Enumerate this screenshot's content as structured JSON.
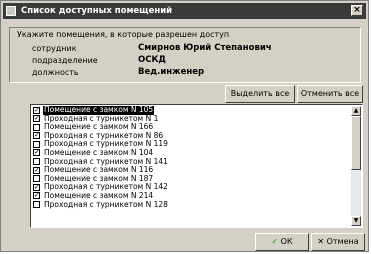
{
  "window": {
    "title": "Список доступных помещений",
    "close_glyph": "×"
  },
  "info": {
    "hint": "Укажите помещения, в которые разрешен доступ",
    "fields": [
      {
        "label": "сотрудник",
        "value": "Смирнов Юрий Степанович"
      },
      {
        "label": "подразделение",
        "value": "ОСКД"
      },
      {
        "label": "должность",
        "value": "Вед.инженер"
      }
    ]
  },
  "buttons": {
    "select_all": "Выделить все",
    "deselect_all": "Отменить все",
    "ok": "ОК",
    "cancel": "Отмена"
  },
  "rooms": [
    {
      "label": "Помещение с замком N 105",
      "checked": true,
      "selected": true
    },
    {
      "label": "Проходная с турникетом N 1",
      "checked": true,
      "selected": false
    },
    {
      "label": "Помещение с замком N 166",
      "checked": false,
      "selected": false
    },
    {
      "label": "Проходная с турникетом N 86",
      "checked": true,
      "selected": false
    },
    {
      "label": "Проходная с турникетом N 119",
      "checked": false,
      "selected": false
    },
    {
      "label": "Помещение с замком N 104",
      "checked": true,
      "selected": false
    },
    {
      "label": "Проходная с турникетом N 141",
      "checked": false,
      "selected": false
    },
    {
      "label": "Помещение с замком N 116",
      "checked": true,
      "selected": false
    },
    {
      "label": "Помещение с замком N 187",
      "checked": false,
      "selected": false
    },
    {
      "label": "Проходная с турникетом N 142",
      "checked": true,
      "selected": false
    },
    {
      "label": "Помещение с замком N 214",
      "checked": true,
      "selected": false
    },
    {
      "label": "Проходная с турникетом N 128",
      "checked": false,
      "selected": false
    }
  ]
}
